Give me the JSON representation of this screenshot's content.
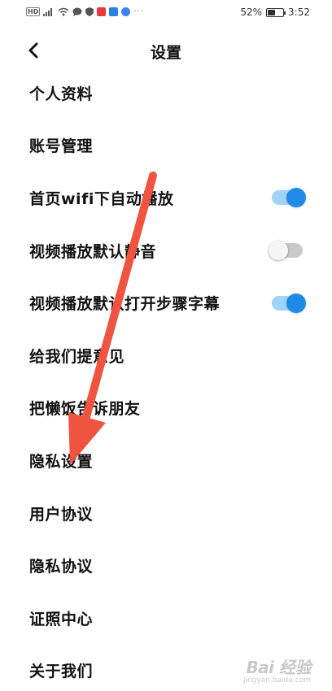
{
  "status_bar": {
    "hd": "HD",
    "battery_text": "52%",
    "battery_level": 0.52,
    "time": "3:52",
    "more": "···"
  },
  "nav": {
    "title": "设置"
  },
  "menu": [
    {
      "label": "个人资料"
    },
    {
      "label": "账号管理"
    },
    {
      "label": "首页wifi下自动播放",
      "toggle": "on"
    },
    {
      "label": "视频播放默认静音",
      "toggle": "off"
    },
    {
      "label": "视频播放默认打开步骤字幕",
      "toggle": "on"
    },
    {
      "label": "给我们提意见"
    },
    {
      "label": "把懒饭告诉朋友"
    },
    {
      "label": "隐私设置"
    },
    {
      "label": "用户协议"
    },
    {
      "label": "隐私协议"
    },
    {
      "label": "证照中心"
    },
    {
      "label": "关于我们"
    }
  ],
  "colors": {
    "toggle_on_knob": "#1e8be8",
    "toggle_on_track": "#9fd3f7",
    "toggle_off_track": "#c9c9c9",
    "arrow": "#ee5440"
  },
  "watermark": {
    "logo": "Bai 经验",
    "sub": "jingyan.baidu.com"
  }
}
